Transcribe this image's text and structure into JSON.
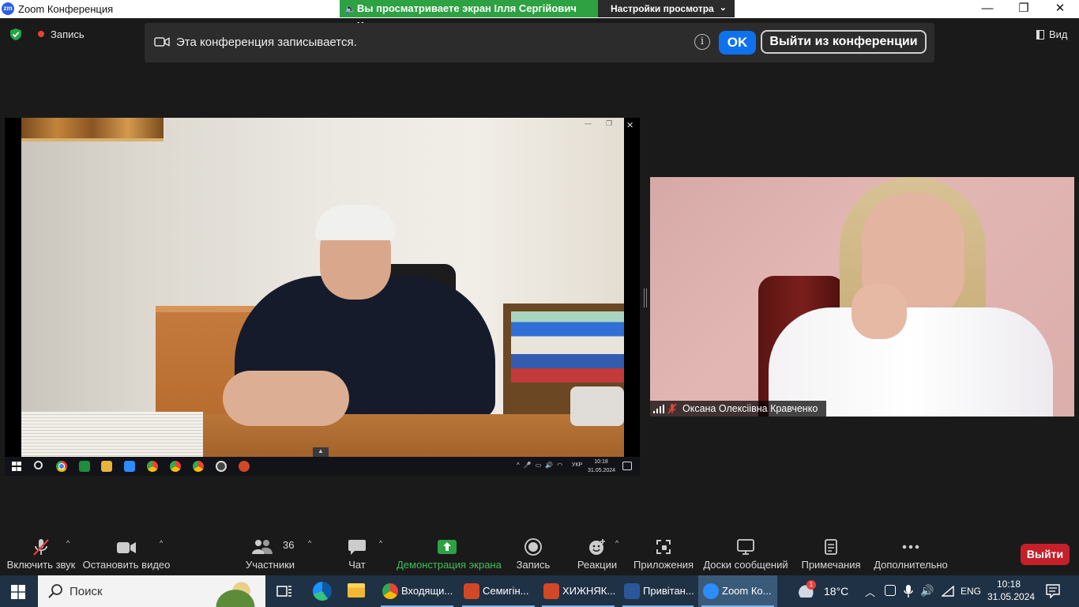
{
  "window": {
    "title": "Zoom Конференция",
    "app_icon_text": "zm"
  },
  "share_banner": {
    "text": "Вы просматриваете экран Ілля Сергійович Хомов",
    "view_settings": "Настройки просмотра"
  },
  "meeting": {
    "recording_label": "Запись",
    "view_label": "Вид"
  },
  "notice": {
    "text": "Эта конференция записывается.",
    "info": "i",
    "ok": "OK",
    "leave": "Выйти из конференции"
  },
  "shared_screen": {
    "taskbar": {
      "lang": "УКР",
      "time": "10:18",
      "date": "31.05.2024"
    }
  },
  "participant": {
    "name": "Оксана Олексіівна Кравченко"
  },
  "toolbar": {
    "audio": "Включить звук",
    "video": "Остановить видео",
    "participants": "Участники",
    "participants_count": "36",
    "chat": "Чат",
    "share": "Демонстрация экрана",
    "record": "Запись",
    "reactions": "Реакции",
    "apps": "Приложения",
    "whiteboards": "Доски сообщений",
    "notes": "Примечания",
    "more": "Дополнительно",
    "leave": "Выйти"
  },
  "taskbar": {
    "search_placeholder": "Поиск",
    "apps": [
      {
        "label": "Входящи...",
        "color": "#e0432f"
      },
      {
        "label": "Семигін...",
        "color": "#d24726"
      },
      {
        "label": "ХИЖНЯК...",
        "color": "#d24726"
      },
      {
        "label": "Привітан...",
        "color": "#2b579a"
      },
      {
        "label": "Zoom Ко...",
        "color": "#2d8cff"
      }
    ],
    "temperature": "18°C",
    "lang": "ENG",
    "time": "10:18",
    "date": "31.05.2024",
    "weather_badge": "1"
  },
  "colors": {
    "share_green": "#2ea143",
    "ok_blue": "#0e72ed",
    "leave_red": "#c5202a",
    "taskbar": "#1f3144"
  }
}
